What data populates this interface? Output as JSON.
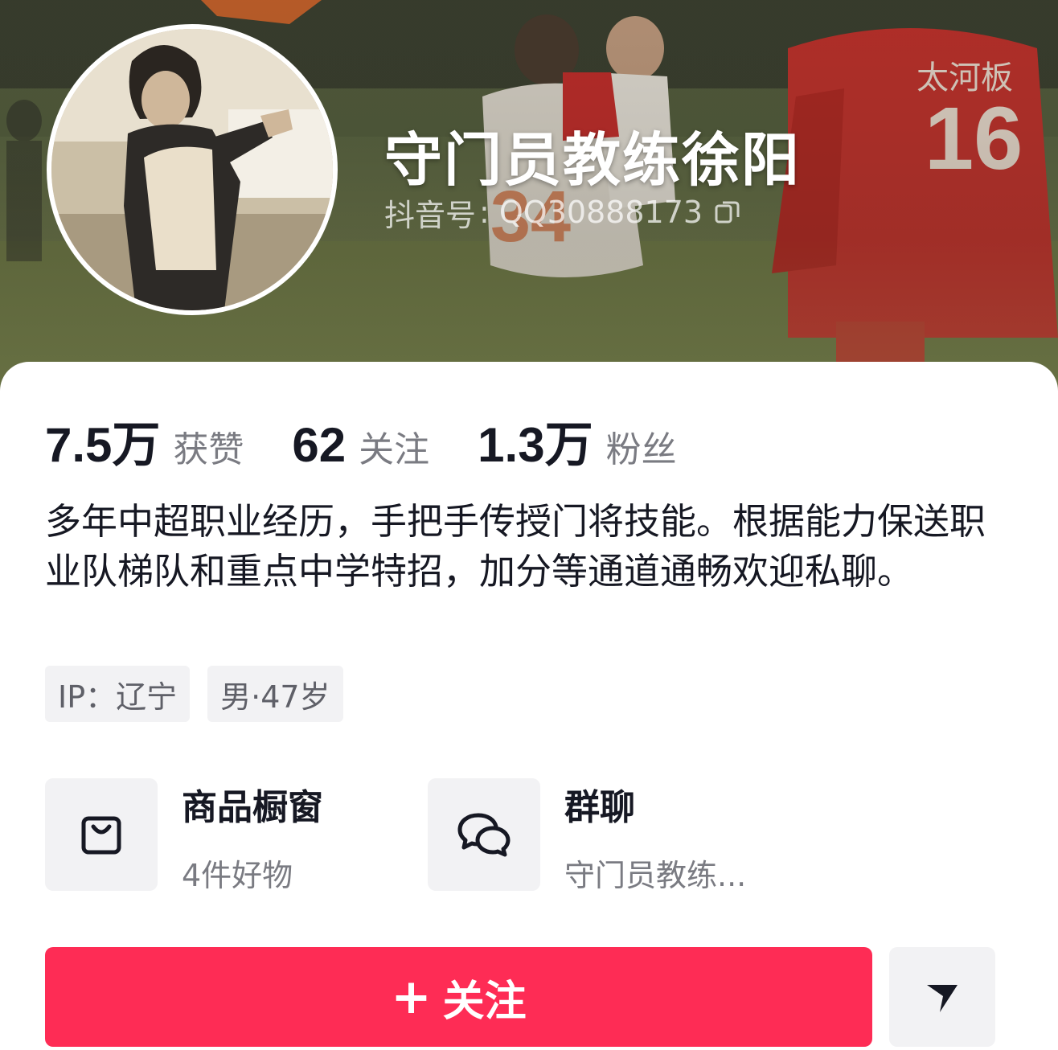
{
  "profile": {
    "display_name": "守门员教练徐阳",
    "douyin_id_label": "抖音号",
    "douyin_id_sep": ":",
    "douyin_id": "QQ30888173"
  },
  "stats": [
    {
      "value": "7.5万",
      "label": "获赞"
    },
    {
      "value": "62",
      "label": "关注"
    },
    {
      "value": "1.3万",
      "label": "粉丝"
    }
  ],
  "bio": "多年中超职业经历，手把手传授门将技能。根据能力保送职业队梯队和重点中学特招，加分等通道通畅欢迎私聊。",
  "tags": [
    {
      "text": "IP：辽宁"
    },
    {
      "text": "男·47岁"
    }
  ],
  "features": [
    {
      "title": "商品橱窗",
      "subtitle": "4件好物",
      "icon": "shopping-bag-icon"
    },
    {
      "title": "群聊",
      "subtitle": "守门员教练...",
      "icon": "chat-bubbles-icon"
    }
  ],
  "actions": {
    "follow_plus": "+",
    "follow_label": "关注",
    "more_icon": "chevron-down-icon"
  },
  "colors": {
    "follow_button": "#fe2c55",
    "text_primary": "#161823",
    "text_secondary": "#7a7b82",
    "chip_background": "#f2f2f4"
  }
}
